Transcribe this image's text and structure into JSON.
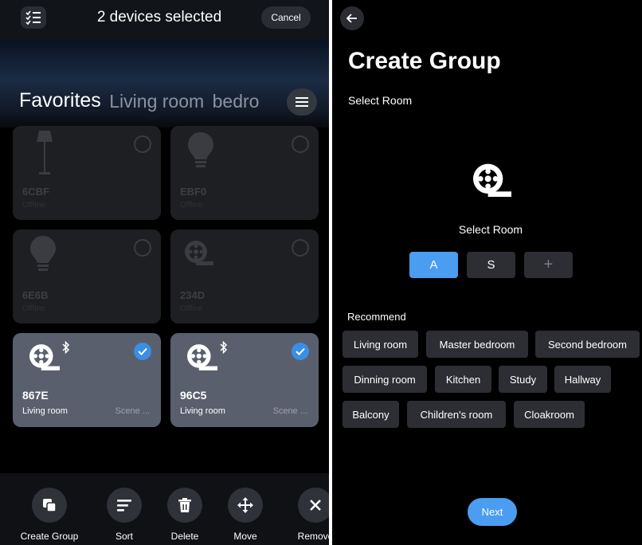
{
  "left": {
    "header": {
      "title": "2 devices selected",
      "cancel_label": "Cancel"
    },
    "tabs": [
      {
        "label": "Favorites",
        "active": true
      },
      {
        "label": "Living room",
        "active": false
      },
      {
        "label": "bedro",
        "active": false
      }
    ],
    "devices": [
      {
        "name": "6CBF",
        "status": "Offline",
        "icon": "floor-lamp-icon",
        "selected": false
      },
      {
        "name": "EBF0",
        "status": "Offline",
        "icon": "bulb-icon",
        "selected": false
      },
      {
        "name": "6E6B",
        "status": "Offline",
        "icon": "bulb-icon",
        "selected": false
      },
      {
        "name": "234D",
        "status": "Offline",
        "icon": "light-strip-icon",
        "selected": false
      },
      {
        "name": "867E",
        "room": "Living room",
        "scene": "Scene ...",
        "icon": "light-strip-icon",
        "selected": true,
        "bluetooth": true
      },
      {
        "name": "96C5",
        "room": "Living room",
        "scene": "Scene ...",
        "icon": "light-strip-icon",
        "selected": true,
        "bluetooth": true
      }
    ],
    "toolbar": [
      {
        "label": "Create Group",
        "icon": "copy-icon"
      },
      {
        "label": "Sort",
        "icon": "sort-icon"
      },
      {
        "label": "Delete",
        "icon": "trash-icon"
      },
      {
        "label": "Move",
        "icon": "move-icon"
      },
      {
        "label": "Remove",
        "icon": "remove-icon"
      }
    ]
  },
  "right": {
    "title": "Create Group",
    "subtitle": "Select Room",
    "select_room_label": "Select Room",
    "room_options": [
      {
        "label": "A",
        "selected": true
      },
      {
        "label": "S",
        "selected": false
      },
      {
        "label": "+",
        "selected": false
      }
    ],
    "recommend_label": "Recommend",
    "recommend_chips": [
      "Living room",
      "Master bedroom",
      "Second bedroom",
      "Dinning room",
      "Kitchen",
      "Study",
      "Hallway",
      "Balcony",
      "Children's room",
      "Cloakroom"
    ],
    "next_label": "Next"
  },
  "colors": {
    "accent": "#4a9df0",
    "check": "#3a8ee6",
    "selected_card": "#5a5f6e",
    "offline_card": "#1e1f22"
  }
}
